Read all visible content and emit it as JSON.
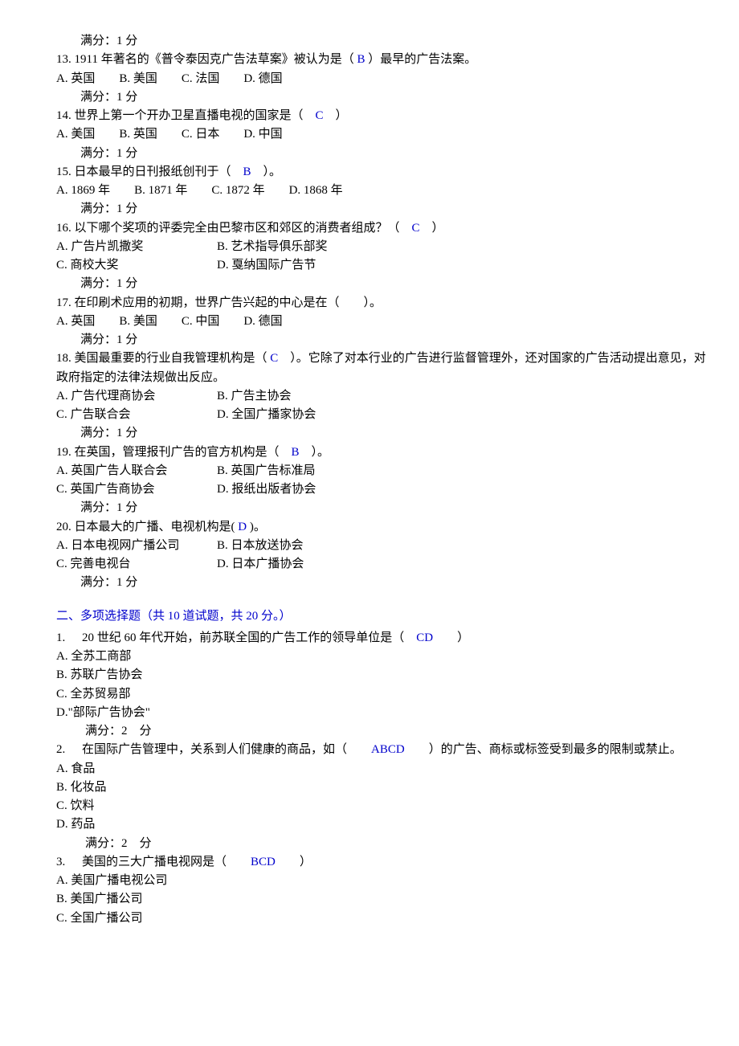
{
  "scoreLabel": "满分：1 分",
  "scoreLabel2": "满分：2　分",
  "q13": {
    "text_a": "13. 1911 年著名的《普令泰因克广告法草案》被认为是（",
    "ans": " B ",
    "text_b": "）最早的广告法案。",
    "opts": "A.  英国　　B. 美国　　C. 法国　　D. 德国"
  },
  "q14": {
    "text_a": "14. 世界上第一个开办卫星直播电视的国家是（",
    "ans": "　C　",
    "text_b": "）",
    "opts": "A.  美国　　B. 英国　　C. 日本　　D. 中国"
  },
  "q15": {
    "text_a": "15. 日本最早的日刊报纸创刊于（",
    "ans": "　B　",
    "text_b": "）。",
    "opts": "A. 1869 年　　B. 1871 年　　C. 1872 年　　D. 1868 年"
  },
  "q16": {
    "text_a": "16. 以下哪个奖项的评委完全由巴黎市区和郊区的消费者组成？（",
    "ans": "　C　",
    "text_b": "）",
    "optsA": "A.  广告片凯撒奖",
    "optsB": "B. 艺术指导俱乐部奖",
    "optsC": "C. 商校大奖",
    "optsD": "D. 戛纳国际广告节"
  },
  "q17": {
    "text": "17. 在印刷术应用的初期，世界广告兴起的中心是在（　　）。",
    "opts": "A.  英国　　B. 美国　　C. 中国　　D. 德国"
  },
  "q18": {
    "text_a": "18. 美国最重要的行业自我管理机构是（",
    "ans": " C　",
    "text_b": "）。它除了对本行业的广告进行监督管理外，还对国家的广告活动提出意见，对政府指定的法律法规做出反应。",
    "optsA": "A.  广告代理商协会",
    "optsB": "B. 广告主协会",
    "optsC": "C. 广告联合会",
    "optsD": "D. 全国广播家协会"
  },
  "q19": {
    "text_a": "19. 在英国，管理报刊广告的官方机构是（",
    "ans": "　B　",
    "text_b": "）。",
    "optsA": "A.  英国广告人联合会",
    "optsB": "B. 英国广告标准局",
    "optsC": "C. 英国广告商协会",
    "optsD": "D. 报纸出版者协会"
  },
  "q20": {
    "text_a": "20. 日本最大的广播、电视机构是(",
    "ans": " D ",
    "text_b": " )。",
    "optsA": "A.  日本电视网广播公司",
    "optsB": "B. 日本放送协会",
    "optsC": "C. 完善电视台",
    "optsD": "D. 日本广播协会"
  },
  "section2": "二、多项选择题（共  10  道试题，共  20  分。）",
  "m1": {
    "num": "1.",
    "text_a": "20 世纪 60 年代开始，前苏联全国的广告工作的领导单位是（",
    "ans": "　CD　　",
    "text_b": "）",
    "a": "A. 全苏工商部",
    "b": "B. 苏联广告协会",
    "c": "C. 全苏贸易部",
    "d": "D.\"部际广告协会\""
  },
  "m2": {
    "num": "2.",
    "text_a": "在国际广告管理中，关系到人们健康的商品，如（",
    "ans": "　　ABCD　　",
    "text_b": "）的广告、商标或标签受到最多的限制或禁止。",
    "a": "A. 食品",
    "b": "B. 化妆品",
    "c": "C. 饮料",
    "d": "D. 药品"
  },
  "m3": {
    "num": "3.",
    "text_a": "美国的三大广播电视网是（",
    "ans": "　　BCD　　",
    "text_b": "）",
    "a": "A. 美国广播电视公司",
    "b": "B. 美国广播公司",
    "c": "C. 全国广播公司"
  }
}
